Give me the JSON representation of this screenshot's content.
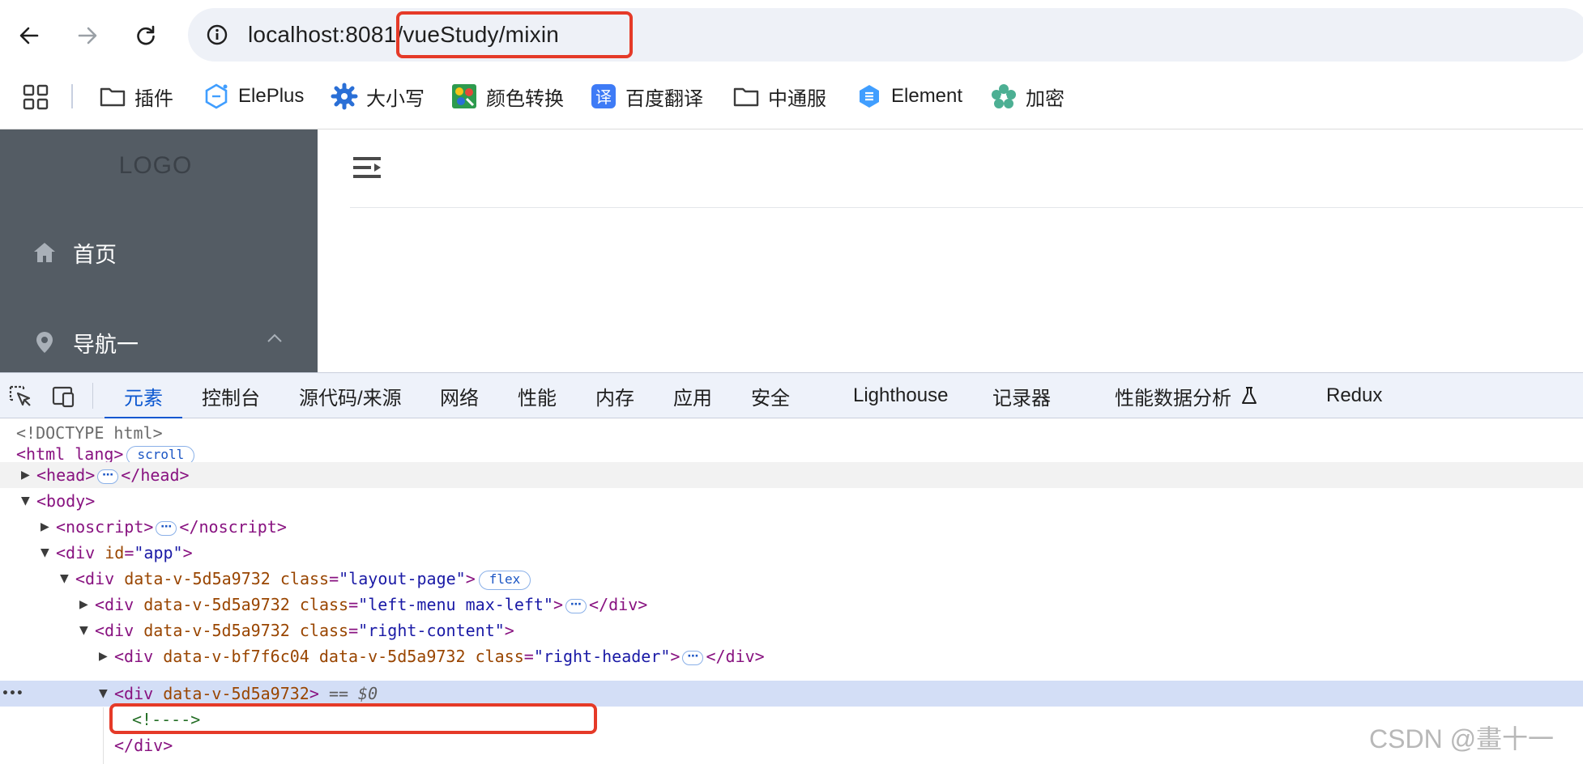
{
  "browser": {
    "back_icon": "arrow-left-icon",
    "forward_icon": "arrow-right-icon",
    "reload_icon": "reload-icon",
    "site_info_icon": "info-circle-icon",
    "url": "localhost:8081/vueStudy/mixin"
  },
  "bookmarks": [
    {
      "label": "插件",
      "icon": "folder-icon"
    },
    {
      "label": "ElePlus",
      "icon": "hexagon-icon"
    },
    {
      "label": "大小写",
      "icon": "gear-icon"
    },
    {
      "label": "颜色转换",
      "icon": "palette-icon"
    },
    {
      "label": "百度翻译",
      "icon": "translate-icon"
    },
    {
      "label": "中通服",
      "icon": "folder-icon"
    },
    {
      "label": "Element",
      "icon": "hexagon-icon"
    },
    {
      "label": "加密",
      "icon": "flower-icon"
    }
  ],
  "page": {
    "logo": "LOGO",
    "menu": [
      {
        "label": "首页",
        "icon": "home-icon"
      },
      {
        "label": "导航一",
        "icon": "location-icon"
      }
    ]
  },
  "devtools": {
    "tabs": [
      "元素",
      "控制台",
      "源代码/来源",
      "网络",
      "性能",
      "内存",
      "应用",
      "安全",
      "Lighthouse",
      "记录器",
      "性能数据分析",
      "Redux"
    ],
    "active_tab": "元素",
    "badges": {
      "scroll": "scroll",
      "flex": "flex",
      "dots": "⋯"
    },
    "dom": {
      "doctype": "<!DOCTYPE html>",
      "html_open": "<html lang>",
      "head_open": "<head>",
      "head_close": "</head>",
      "body_open": "<body>",
      "noscript_open": "<noscript>",
      "noscript_close": "</noscript>",
      "div_app_tag": "<div",
      "div_app_attr": "id",
      "div_app_val": "\"app\"",
      "layout_attr1": "data-v-5d5a9732",
      "layout_attr2": "class",
      "layout_val": "\"layout-page\"",
      "left_val": "\"left-menu max-left\"",
      "right_val": "\"right-content\"",
      "header_attr1": "data-v-bf7f6c04",
      "header_val": "\"right-header\"",
      "selected_attr": "data-v-5d5a9732",
      "selected_eq": "== $0",
      "comment": "<!---->",
      "div_close": "</div>"
    }
  },
  "watermark": "CSDN @畫十一"
}
